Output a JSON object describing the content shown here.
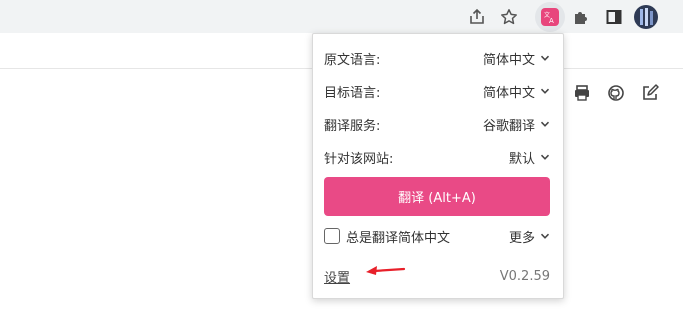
{
  "toolbar": {
    "icons": [
      "share-icon",
      "star-icon",
      "translate-extension-icon",
      "puzzle-icon",
      "sidebar-icon",
      "avatar"
    ]
  },
  "page_icons": [
    "print-icon",
    "github-icon",
    "edit-icon"
  ],
  "popup": {
    "rows": [
      {
        "label": "原文语言:",
        "value": "简体中文"
      },
      {
        "label": "目标语言:",
        "value": "简体中文"
      },
      {
        "label": "翻译服务:",
        "value": "谷歌翻译"
      },
      {
        "label": "针对该网站:",
        "value": "默认"
      }
    ],
    "translate_button": "翻译 (Alt+A)",
    "always_translate_label": "总是翻译简体中文",
    "always_translate_checked": false,
    "more_label": "更多",
    "settings_link": "设置",
    "version": "V0.2.59"
  },
  "colors": {
    "accent": "#e94a86",
    "arrow": "#e8202a"
  }
}
